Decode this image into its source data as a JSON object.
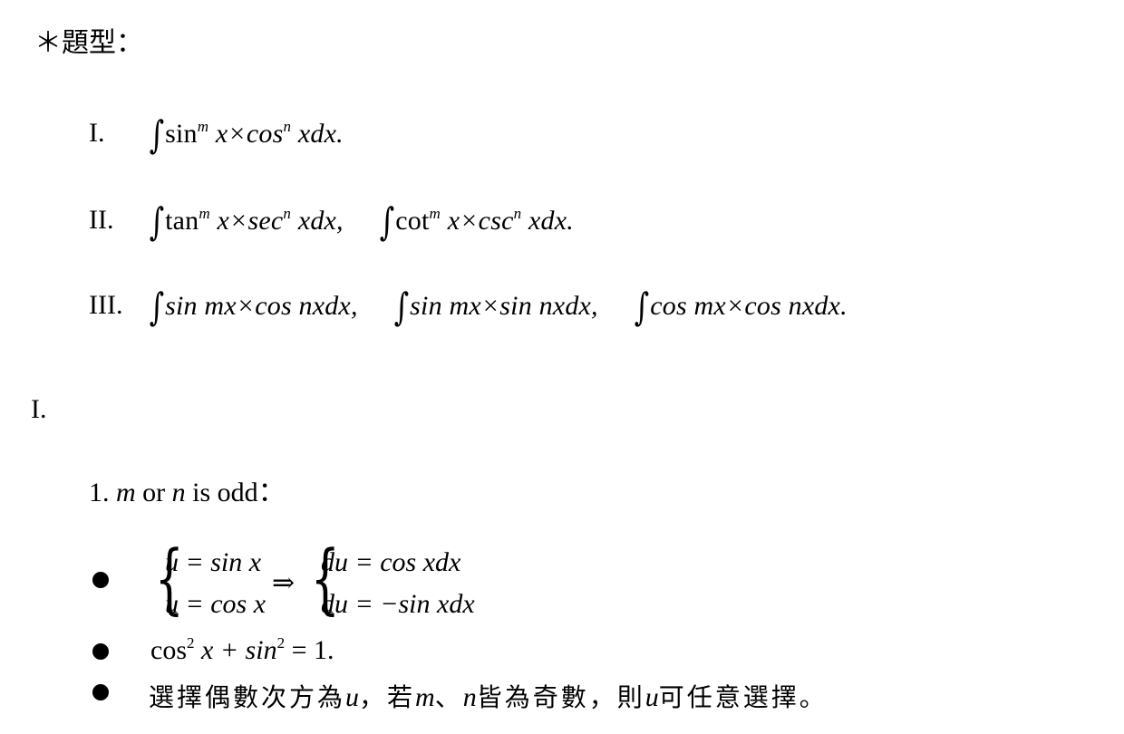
{
  "heading": "＊題型：",
  "types": [
    {
      "label": "I.",
      "formula": [
        {
          "int": "∫",
          "text": "sin",
          "sup": "m",
          "rest": " x×cos",
          "sup2": "n",
          "tail": " xdx."
        }
      ]
    },
    {
      "label": "II.",
      "formula": [
        {
          "int": "∫",
          "text": "tan",
          "sup": "m",
          "rest": " x×sec",
          "sup2": "n",
          "tail": " xdx,"
        },
        {
          "int": "∫",
          "text": "cot",
          "sup": "m",
          "rest": " x×csc",
          "sup2": "n",
          "tail": " xdx."
        }
      ]
    },
    {
      "label": "III.",
      "formula": [
        {
          "int": "∫",
          "text": "sin mx×cos nxdx,"
        },
        {
          "int": "∫",
          "text": "sin mx×sin nxdx,"
        },
        {
          "int": "∫",
          "text": "cos mx×cos nxdx."
        }
      ]
    }
  ],
  "section": "I.",
  "case1": {
    "number": "1.",
    "m": "m",
    "or": "or",
    "n": "n",
    "rest": "is odd："
  },
  "substitution": {
    "u1": "u = sin x",
    "u2": "u = cos x",
    "arrow": "⇒",
    "du1": "du = cos xdx",
    "du2": "du = −sin xdx"
  },
  "identity": {
    "cos": "cos",
    "exp1": "2",
    "mid": " x + sin",
    "exp2": "2",
    "end": " = 1."
  },
  "note": {
    "p1": "選擇偶數次方為",
    "u": "u",
    "p2": "，若",
    "m": "m",
    "p3": "、",
    "n": "n",
    "p4": "皆為奇數，則",
    "u2": "u",
    "p5": "可任意選擇。"
  }
}
